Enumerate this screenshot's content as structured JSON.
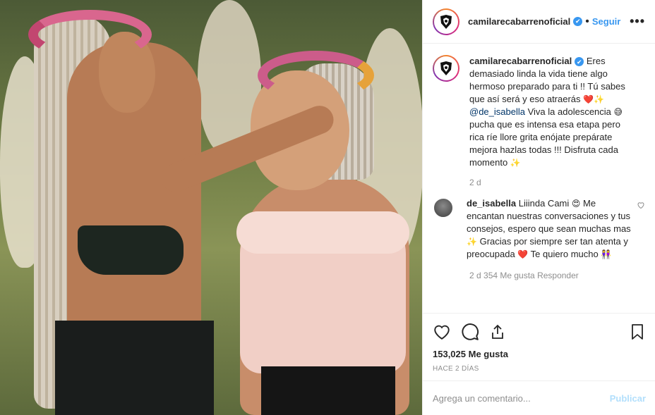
{
  "post": {
    "username": "camilarecabarrenoficial",
    "verified_mark": "✔",
    "separator": "•",
    "follow_label": "Seguir",
    "more_label": "•••"
  },
  "caption": {
    "username": "camilarecabarrenoficial",
    "text_1": "Eres demasiado linda la vida tiene algo hermoso preparado para ti !! Tú sabes que así será y eso atraerás",
    "emoji_1": "❤️✨",
    "mention": "@de_isabella",
    "text_2": "Viva la adolescencia",
    "emoji_2": "😅",
    "text_3": "pucha que es intensa esa etapa pero rica ríe llore grita enójate prepárate mejora hazlas todas !!! Disfruta cada momento",
    "emoji_3": "✨",
    "time": "2 d"
  },
  "comments": [
    {
      "username": "de_isabella",
      "text_1": "Liiinda Cami",
      "emoji_1": "😍",
      "text_2": "Me encantan nuestras conversaciones y tus consejos, espero que sean muchas mas",
      "emoji_2": "✨",
      "text_3": "Gracias por siempre ser tan atenta y preocupada",
      "emoji_3": "❤️",
      "text_4": "Te quiero mucho",
      "emoji_4": "👭",
      "meta_clipped": "2 d     354 Me gusta     Responder"
    }
  ],
  "likes": {
    "count": "153,025",
    "label": "Me gusta"
  },
  "posted_ago": "HACE 2 DÍAS",
  "add_comment": {
    "placeholder": "Agrega un comentario...",
    "publish_label": "Publicar"
  },
  "icons": {
    "like": "heart-icon",
    "comment": "comment-icon",
    "share": "share-icon",
    "save": "bookmark-icon",
    "comment_like": "heart-small-icon"
  },
  "colors": {
    "link": "#3897f0",
    "publish_disabled": "#b2dffc",
    "secondary_text": "#8e8e8e",
    "divider": "#efefef"
  }
}
